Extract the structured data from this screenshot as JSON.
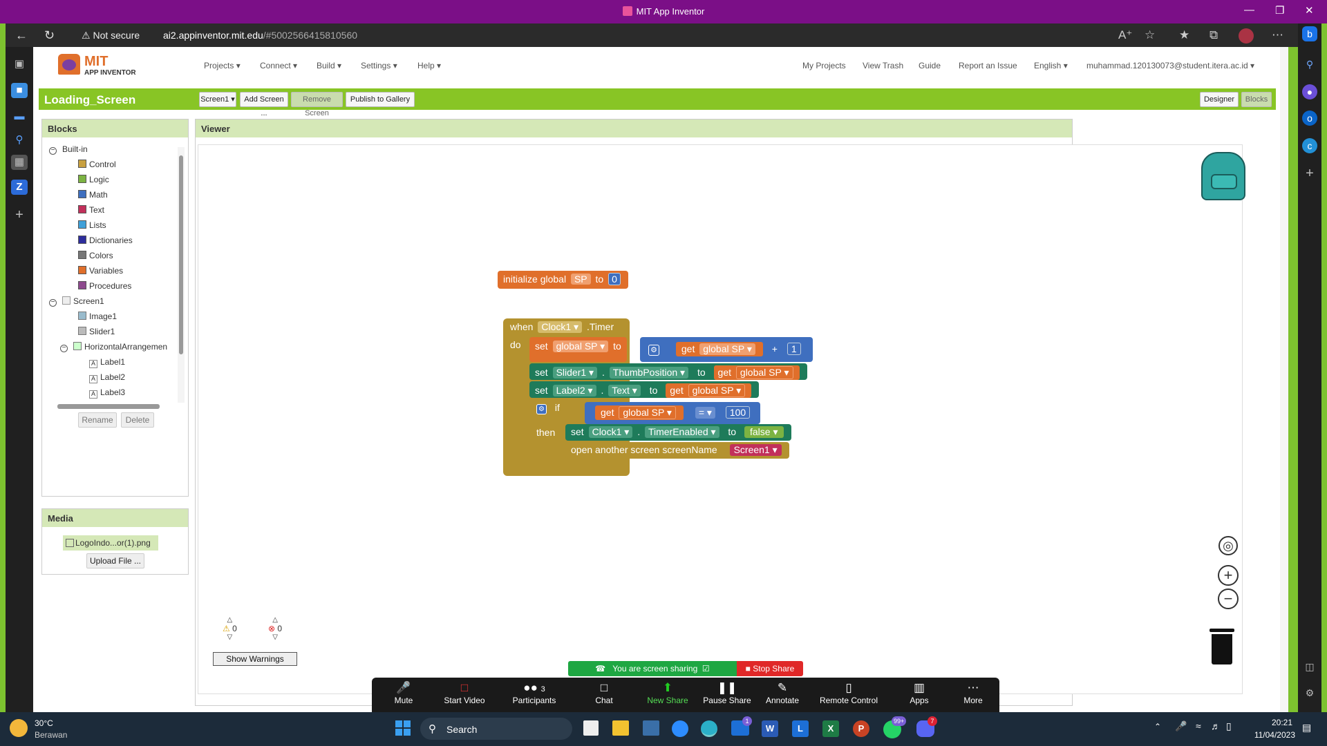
{
  "window": {
    "title": "MIT App Inventor"
  },
  "browser": {
    "security_label": "Not secure",
    "url_host": "ai2.appinventor.mit.edu",
    "url_path": "/#5002566415810560"
  },
  "app": {
    "logo_top": "MIT",
    "logo_bottom": "APP INVENTOR",
    "menus": [
      "Projects",
      "Connect",
      "Build",
      "Settings",
      "Help"
    ],
    "right_menus": [
      "My Projects",
      "View Trash",
      "Guide",
      "Report an Issue",
      "English",
      "muhammad.120130073@student.itera.ac.id"
    ],
    "screen_name": "Loading_Screen",
    "screen_select": "Screen1",
    "buttons": {
      "add": "Add Screen ...",
      "remove": "Remove Screen",
      "publish": "Publish to Gallery",
      "designer": "Designer",
      "blocks": "Blocks"
    }
  },
  "blocks_panel": {
    "title": "Blocks",
    "builtin": "Built-in",
    "builtin_items": [
      {
        "label": "Control",
        "color": "#c8a040"
      },
      {
        "label": "Logic",
        "color": "#7cb342"
      },
      {
        "label": "Math",
        "color": "#3f6fbf"
      },
      {
        "label": "Text",
        "color": "#c2305b"
      },
      {
        "label": "Lists",
        "color": "#40a0d8"
      },
      {
        "label": "Dictionaries",
        "color": "#2d2d9c"
      },
      {
        "label": "Colors",
        "color": "#777777"
      },
      {
        "label": "Variables",
        "color": "#e06f2b"
      },
      {
        "label": "Procedures",
        "color": "#8e4a8e"
      }
    ],
    "screen": "Screen1",
    "components": [
      "Image1",
      "Slider1",
      "HorizontalArrangemen",
      "Label1",
      "Label2",
      "Label3"
    ],
    "rename": "Rename",
    "delete": "Delete"
  },
  "media_panel": {
    "title": "Media",
    "file": "LogoIndo...or(1).png",
    "upload": "Upload File ..."
  },
  "viewer": {
    "title": "Viewer",
    "warnings_count": "0",
    "errors_count": "0",
    "show_warnings": "Show Warnings"
  },
  "code": {
    "init": {
      "initialize": "initialize global",
      "var": "SP",
      "to": "to",
      "value": "0"
    },
    "event": {
      "when": "when",
      "component": "Clock1",
      "event": ".Timer",
      "do": "do",
      "then": "then"
    },
    "set1": {
      "set": "set",
      "var": "global SP",
      "to": "to",
      "get": "get",
      "getvar": "global SP",
      "op": "+",
      "num": "1"
    },
    "set2": {
      "set": "set",
      "comp": "Slider1",
      "dot": ".",
      "prop": "ThumbPosition",
      "to": "to",
      "get": "get",
      "getvar": "global SP"
    },
    "set3": {
      "set": "set",
      "comp": "Label2",
      "dot": ".",
      "prop": "Text",
      "to": "to",
      "get": "get",
      "getvar": "global SP"
    },
    "if": {
      "if": "if",
      "get": "get",
      "getvar": "global SP",
      "op": "=",
      "num": "100"
    },
    "set4": {
      "set": "set",
      "comp": "Clock1",
      "dot": ".",
      "prop": "TimerEnabled",
      "to": "to",
      "val": "false"
    },
    "open": {
      "label": "open another screen  screenName",
      "screen": "Screen1"
    }
  },
  "zoom": {
    "sharing": "You are screen sharing",
    "stop": "Stop Share",
    "participants_count": "3",
    "buttons": [
      "Mute",
      "Start Video",
      "Participants",
      "Chat",
      "New Share",
      "Pause Share",
      "Annotate",
      "Remote Control",
      "Apps",
      "More"
    ]
  },
  "taskbar": {
    "temp": "30°C",
    "weather": "Berawan",
    "search": "Search",
    "time": "20:21",
    "date": "11/04/2023",
    "badges": {
      "mail": "1",
      "whatsapp": "99+",
      "discord": "7"
    }
  }
}
